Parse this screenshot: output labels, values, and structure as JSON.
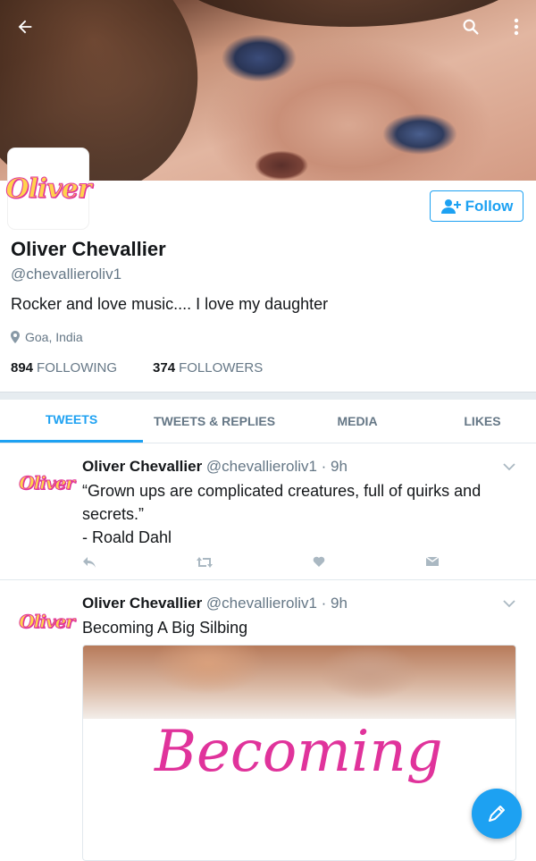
{
  "profile": {
    "display_name": "Oliver Chevallier",
    "handle": "@chevallieroliv1",
    "bio": "Rocker and love music.... I love my daughter",
    "location": "Goa, India",
    "following_count": "894",
    "following_label": "FOLLOWING",
    "followers_count": "374",
    "followers_label": "FOLLOWERS",
    "avatar_logo_text": "Oliver",
    "follow_button_label": "Follow"
  },
  "header": {
    "back_icon": "arrow-back-icon",
    "search_icon": "search-icon",
    "more_icon": "more-vertical-icon"
  },
  "tabs": [
    {
      "label": "TWEETS",
      "active": true
    },
    {
      "label": "TWEETS & REPLIES",
      "active": false
    },
    {
      "label": "MEDIA",
      "active": false
    },
    {
      "label": "LIKES",
      "active": false
    }
  ],
  "tweets": [
    {
      "name": "Oliver Chevallier",
      "meta": "@chevallieroliv1 · 9h",
      "text_line1": "“Grown ups are complicated creatures, full of quirks and secrets.”",
      "text_line2": "- Roald Dahl"
    },
    {
      "name": "Oliver Chevallier",
      "meta": "@chevallieroliv1 · 9h",
      "text_line1": "Becoming A Big Silbing",
      "media_word": "Becoming"
    }
  ],
  "colors": {
    "accent": "#1da1f2",
    "secondary_text": "#657786",
    "logo_pink": "#e0339b",
    "logo_yellow": "#ffd34d"
  }
}
